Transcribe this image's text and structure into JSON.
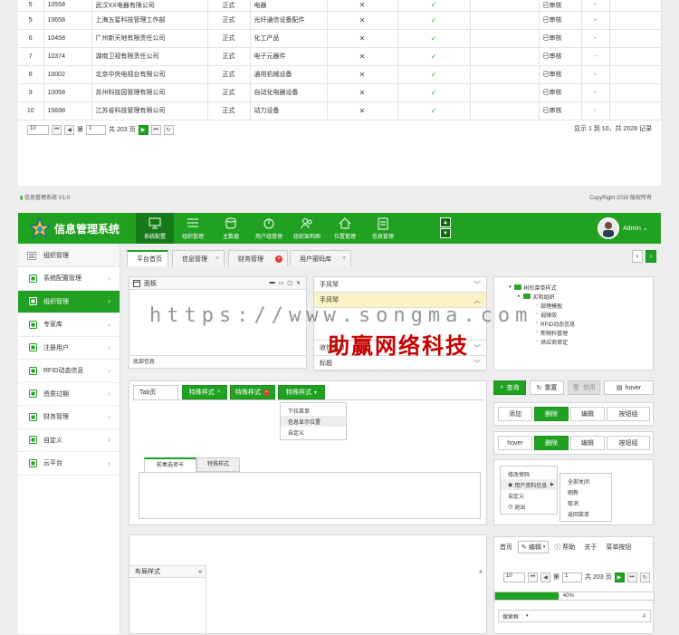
{
  "top_table": {
    "rows": [
      {
        "no": "5",
        "code": "10558",
        "company": "武汉XX电器有限公司",
        "type": "正式",
        "product": "电器",
        "has_x": true,
        "has_check": true,
        "status": "已审核",
        "extra": "-"
      },
      {
        "no": "5",
        "code": "10658",
        "company": "上海五星科技管理工作部",
        "type": "正式",
        "product": "光纤通信设备配件",
        "has_x": true,
        "has_check": true,
        "status": "已审核",
        "extra": "-"
      },
      {
        "no": "6",
        "code": "10458",
        "company": "广州新天地有限责任公司",
        "type": "正式",
        "product": "化工产品",
        "has_x": true,
        "has_check": true,
        "status": "已审核",
        "extra": "-"
      },
      {
        "no": "7",
        "code": "10374",
        "company": "湖南卫视有限责任公司",
        "type": "正式",
        "product": "电子元器件",
        "has_x": true,
        "has_check": true,
        "status": "已审核",
        "extra": "-"
      },
      {
        "no": "8",
        "code": "10002",
        "company": "北京中央电视台有限公司",
        "type": "正式",
        "product": "通用机械设备",
        "has_x": true,
        "has_check": true,
        "status": "已审核",
        "extra": "-"
      },
      {
        "no": "9",
        "code": "10058",
        "company": "苏州科技园管理有限公司",
        "type": "正式",
        "product": "自动化电器设备",
        "has_x": true,
        "has_check": true,
        "status": "已审核",
        "extra": "-"
      },
      {
        "no": "10",
        "code": "15698",
        "company": "江苏省科技管理有限公司",
        "type": "正式",
        "product": "动力设备",
        "has_x": true,
        "has_check": true,
        "status": "已审核",
        "extra": "-"
      }
    ],
    "x_glyph": "✕",
    "check_glyph": "✓",
    "pager": {
      "page_size": "10",
      "page_prefix": "第",
      "page_value": "1",
      "page_suffix": "共 203 页",
      "summary": "显示 1 到 10，共 2028 记录"
    }
  },
  "top_footer": {
    "left": "信息管理系统 V1.0",
    "right": "CopyRight 2016  版权所有"
  },
  "header": {
    "title": "信息管理系统",
    "nav": [
      {
        "label": "系统配置",
        "icon": "monitor-icon",
        "active": true
      },
      {
        "label": "组织管理",
        "icon": "list-icon",
        "active": false
      },
      {
        "label": "主数据",
        "icon": "database-icon",
        "active": false
      },
      {
        "label": "用户组管理",
        "icon": "power-icon",
        "active": false
      },
      {
        "label": "组织架构图",
        "icon": "users-icon",
        "active": false
      },
      {
        "label": "位置管理",
        "icon": "house-icon",
        "active": false
      },
      {
        "label": "信息管理",
        "icon": "document-icon",
        "active": false
      }
    ],
    "user_name": "Admin",
    "toggle_up": "▲",
    "toggle_down": "▼",
    "dropdown_glyph": "⌄"
  },
  "sidebar": {
    "title": "组织管理",
    "items": [
      {
        "label": "系统配置管理",
        "active": false
      },
      {
        "label": "组织管理",
        "active": true
      },
      {
        "label": "专家库",
        "active": false
      },
      {
        "label": "注册用户",
        "active": false
      },
      {
        "label": "RFID动态信息",
        "active": false
      },
      {
        "label": "资质过期",
        "active": false
      },
      {
        "label": "财务管理",
        "active": false
      },
      {
        "label": "自定义",
        "active": false
      },
      {
        "label": "云平台",
        "active": false
      }
    ],
    "chevron": "›"
  },
  "tabs": [
    {
      "label": "平台首页",
      "active": true,
      "close": ""
    },
    {
      "label": "信息管理",
      "active": false,
      "close": "×"
    },
    {
      "label": "财务管理",
      "active": false,
      "close": "×"
    },
    {
      "label": "用户密码库",
      "active": false,
      "close": "×"
    }
  ],
  "tab_arrows": {
    "left": "‹",
    "right": "›"
  },
  "panel_window": {
    "title": "面板",
    "footer": "底部信息",
    "controls": [
      "▬",
      "▭",
      "▢",
      "✕"
    ]
  },
  "accordion": {
    "rows": [
      "手风琴",
      "手风琴",
      "收信菜单",
      "标题"
    ],
    "up": "︿",
    "down": "﹀"
  },
  "tree": {
    "nodes": [
      "树形菜单样式",
      "买和组织",
      "部理模板",
      "弱弹效",
      "RFID动态信息",
      "新物料管理",
      "供应商审定"
    ]
  },
  "tabs_widget": {
    "tabs": [
      "Tab页",
      "特殊样式",
      "特殊样式",
      "特殊样式"
    ],
    "dropdown": [
      "下拉菜单",
      "信息显示位置",
      "自定义"
    ],
    "inner_tabs": [
      "前奏选项卡",
      "特殊样式"
    ]
  },
  "buttons": {
    "row1": [
      "查询",
      "重置",
      "禁用",
      "hover"
    ],
    "row2": [
      "添加",
      "删除",
      "编辑",
      "按钮组"
    ],
    "row3": [
      "hover",
      "删除",
      "编辑",
      "按钮组"
    ]
  },
  "context_menu": {
    "items": [
      "修改密码",
      "用户资料信息",
      "自定义",
      "退出"
    ],
    "submenu": [
      "全部关闭",
      "刷新",
      "取消",
      "返回菜单"
    ]
  },
  "layout_panel": {
    "title": "布局样式",
    "left_arrows": "»",
    "right_arrows": "«"
  },
  "toolbar": {
    "items": [
      "首页",
      "编辑",
      "帮助",
      "关于",
      "菜单按钮"
    ]
  },
  "mini_pager": {
    "page_size": "10",
    "page_prefix": "第",
    "page_value": "1",
    "page_suffix": "共 203 页"
  },
  "progress": {
    "value": 40,
    "label": "40%"
  },
  "search": {
    "value": "搜索框"
  },
  "watermark": {
    "url": "https://www.songma.com",
    "cn": "助赢网络科技"
  },
  "colors": {
    "brand": "#21a122",
    "brand_dark": "#167b17"
  }
}
